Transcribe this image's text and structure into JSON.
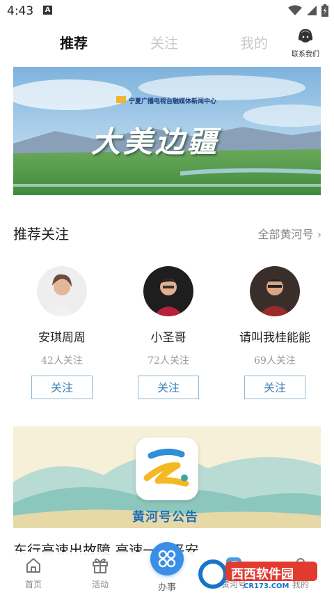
{
  "status_bar": {
    "time": "4:43",
    "app_badge": "A"
  },
  "tabs": [
    {
      "label": "推荐",
      "active": true
    },
    {
      "label": "关注",
      "active": false
    },
    {
      "label": "我的",
      "active": false
    }
  ],
  "contact": {
    "label": "联系我们"
  },
  "banner": {
    "logo_text": "宁夏广播电视台融媒体新闻中心",
    "title": "大美边疆",
    "colors": {
      "sky": "#9ec8e6",
      "grass": "#4f9d49"
    }
  },
  "recommend": {
    "title": "推荐关注",
    "more_label": "全部黄河号",
    "cards": [
      {
        "name": "安琪周周",
        "followers": "42人关注",
        "button": "关注"
      },
      {
        "name": "小圣哥",
        "followers": "72人关注",
        "button": "关注"
      },
      {
        "name": "请叫我桂能能",
        "followers": "69人关注",
        "button": "关注"
      }
    ]
  },
  "notice": {
    "label": "黄河号公告"
  },
  "article": {
    "title": "东行高速出故障 高速一假平安"
  },
  "bottom_nav": [
    {
      "label": "首页",
      "icon": "home-icon"
    },
    {
      "label": "活动",
      "icon": "gift-icon"
    },
    {
      "label": "办事",
      "icon": "grid-icon"
    },
    {
      "label": "黄河号",
      "icon": "yellow-river-icon"
    },
    {
      "label": "我的",
      "icon": "user-icon"
    }
  ],
  "watermark": {
    "brand": "西西软件园",
    "url": "CR173.COM"
  },
  "colors": {
    "accent": "#3a8ee6",
    "follow_border": "#8fb7d3",
    "follow_text": "#3b7fb3"
  }
}
